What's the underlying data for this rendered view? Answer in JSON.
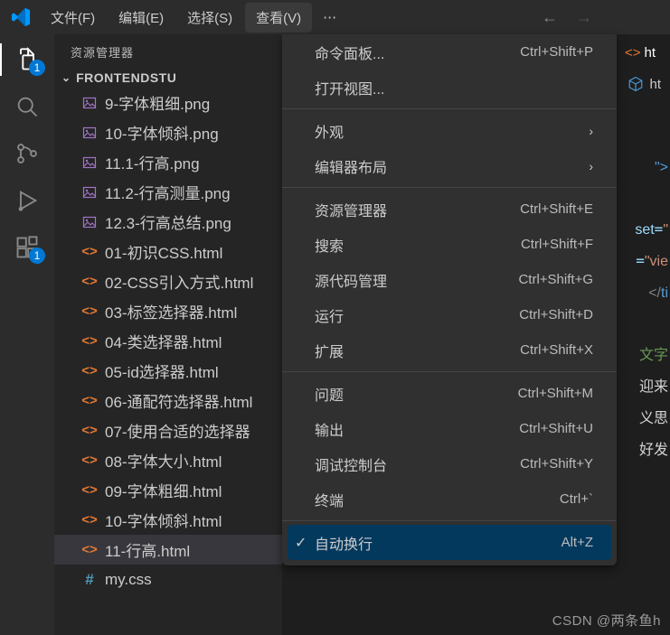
{
  "titlebar": {
    "menus": [
      {
        "label": "文件(F)",
        "active": false
      },
      {
        "label": "编辑(E)",
        "active": false
      },
      {
        "label": "选择(S)",
        "active": false
      },
      {
        "label": "查看(V)",
        "active": true
      }
    ]
  },
  "activity": {
    "explorer_badge": "1",
    "ext_badge": "1"
  },
  "sidebar": {
    "title": "资源管理器",
    "folder": "FRONTENDSTU",
    "files": [
      {
        "name": "9-字体粗细.png",
        "type": "img"
      },
      {
        "name": "10-字体倾斜.png",
        "type": "img"
      },
      {
        "name": "11.1-行高.png",
        "type": "img"
      },
      {
        "name": "11.2-行高测量.png",
        "type": "img"
      },
      {
        "name": "12.3-行高总结.png",
        "type": "img"
      },
      {
        "name": "01-初识CSS.html",
        "type": "html"
      },
      {
        "name": "02-CSS引入方式.html",
        "type": "html"
      },
      {
        "name": "03-标签选择器.html",
        "type": "html"
      },
      {
        "name": "04-类选择器.html",
        "type": "html"
      },
      {
        "name": "05-id选择器.html",
        "type": "html"
      },
      {
        "name": "06-通配符选择器.html",
        "type": "html"
      },
      {
        "name": "07-使用合适的选择器",
        "type": "html"
      },
      {
        "name": "08-字体大小.html",
        "type": "html"
      },
      {
        "name": "09-字体粗细.html",
        "type": "html"
      },
      {
        "name": "10-字体倾斜.html",
        "type": "html"
      },
      {
        "name": "11-行高.html",
        "type": "html",
        "selected": true
      },
      {
        "name": "my.css",
        "type": "css"
      }
    ]
  },
  "menu": {
    "groups": [
      [
        {
          "label": "命令面板...",
          "shortcut": "Ctrl+Shift+P"
        },
        {
          "label": "打开视图...",
          "shortcut": ""
        }
      ],
      [
        {
          "label": "外观",
          "sub": true
        },
        {
          "label": "编辑器布局",
          "sub": true
        }
      ],
      [
        {
          "label": "资源管理器",
          "shortcut": "Ctrl+Shift+E"
        },
        {
          "label": "搜索",
          "shortcut": "Ctrl+Shift+F"
        },
        {
          "label": "源代码管理",
          "shortcut": "Ctrl+Shift+G"
        },
        {
          "label": "运行",
          "shortcut": "Ctrl+Shift+D"
        },
        {
          "label": "扩展",
          "shortcut": "Ctrl+Shift+X"
        }
      ],
      [
        {
          "label": "问题",
          "shortcut": "Ctrl+Shift+M"
        },
        {
          "label": "输出",
          "shortcut": "Ctrl+Shift+U"
        },
        {
          "label": "调试控制台",
          "shortcut": "Ctrl+Shift+Y"
        },
        {
          "label": "终端",
          "shortcut": "Ctrl+`"
        }
      ],
      [
        {
          "label": "自动换行",
          "shortcut": "Alt+Z",
          "checked": true,
          "highlight": true
        }
      ]
    ]
  },
  "editor": {
    "tab_label": "ht",
    "code_lines": [
      "\">",
      "set=\"",
      "=\"vie",
      "</ti",
      "",
      "文字",
      "迎来",
      "义思",
      "好发"
    ]
  },
  "watermark": "CSDN @两条鱼h"
}
